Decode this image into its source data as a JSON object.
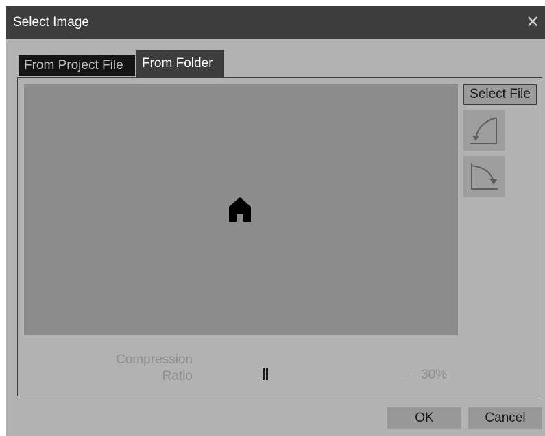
{
  "window": {
    "title": "Select Image",
    "close_icon": "close-icon"
  },
  "tabs": [
    {
      "label": "From Project File",
      "active": false
    },
    {
      "label": "From Folder",
      "active": true
    }
  ],
  "preview": {
    "icon": "home-icon"
  },
  "actions": {
    "select_file_label": "Select File",
    "rotate_left_icon": "rotate-left-icon",
    "rotate_right_icon": "rotate-right-icon"
  },
  "compression": {
    "label_line1": "Compression",
    "label_line2": "Ratio",
    "value_text": "30%",
    "value_fraction": 0.3
  },
  "footer": {
    "ok_label": "OK",
    "cancel_label": "Cancel"
  },
  "colors": {
    "dialog_bg": "#b2b2b2",
    "titlebar_bg": "#3d3d3d",
    "preview_bg": "#8c8c8c",
    "active_tab_bg": "#3d3d3d",
    "inactive_tab_bg": "#141414"
  }
}
